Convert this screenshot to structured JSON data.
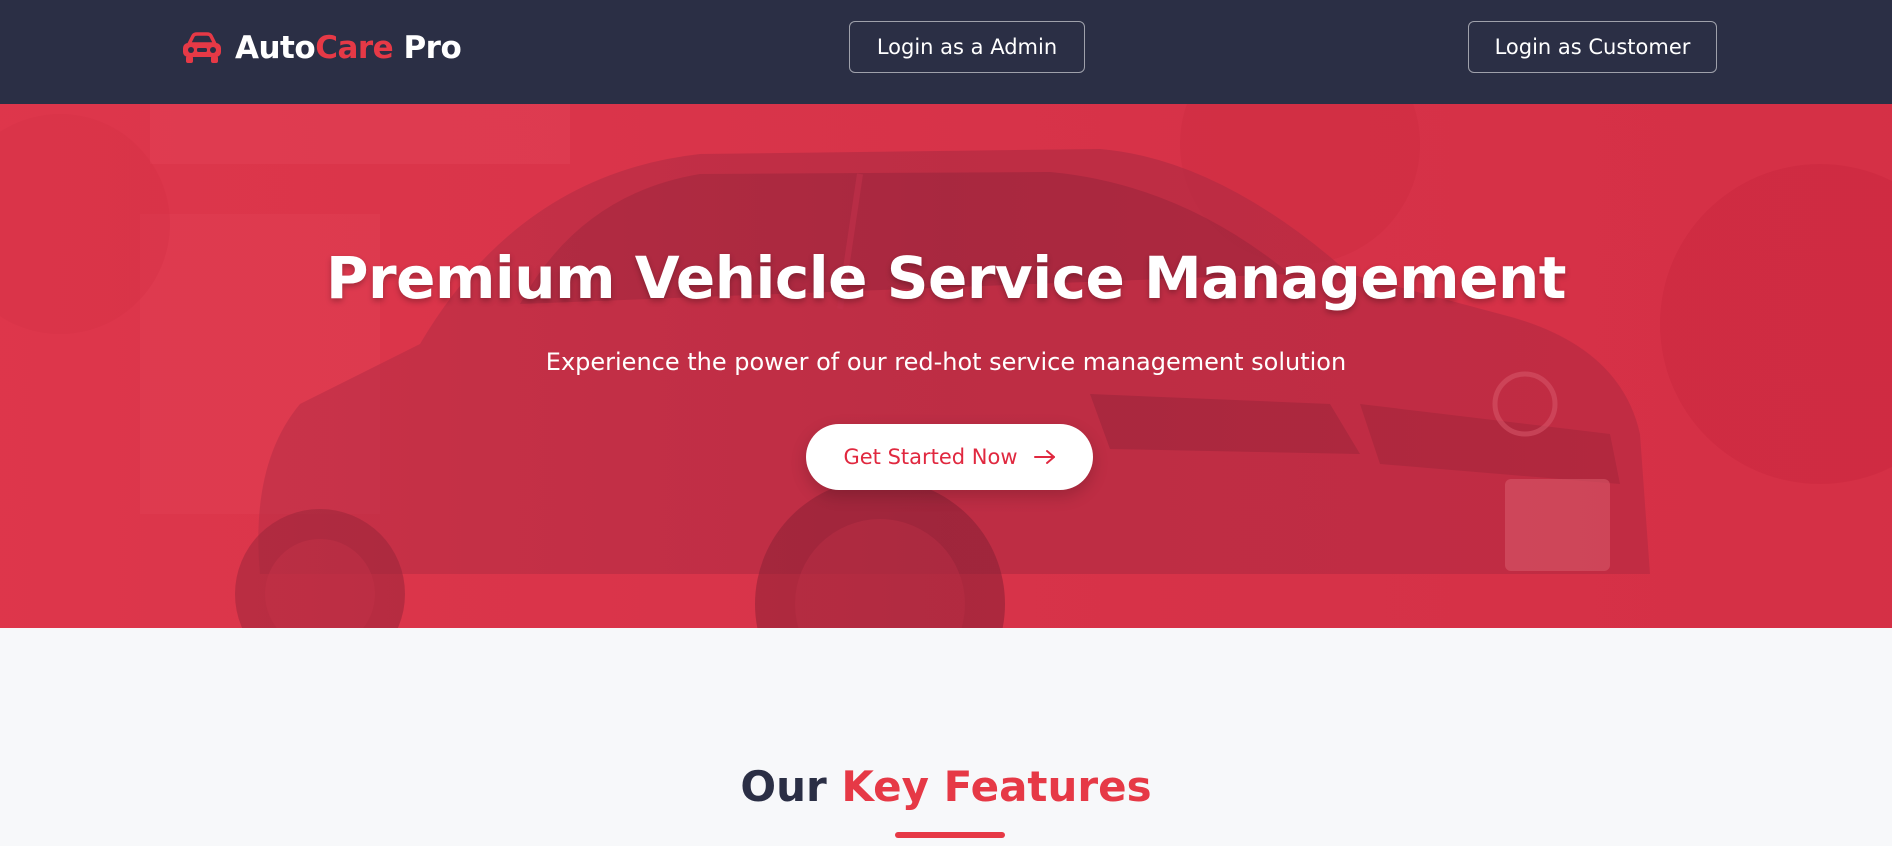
{
  "brand": {
    "part1": "Auto",
    "part2": "Care",
    "part3": " Pro",
    "icon": "car-icon"
  },
  "nav": {
    "admin_label": "Login as a Admin",
    "customer_label": "Login as Customer"
  },
  "hero": {
    "title": "Premium Vehicle Service Management",
    "subtitle": "Experience the power of our red-hot service management solution",
    "cta_label": "Get Started Now",
    "cta_icon": "arrow-right-icon"
  },
  "features": {
    "title_part1": "Our ",
    "title_part2": "Key Features"
  },
  "colors": {
    "navbar": "#2b2f45",
    "accent": "#e63946",
    "hero": "#d63a4e",
    "background": "#f7f8fa"
  }
}
